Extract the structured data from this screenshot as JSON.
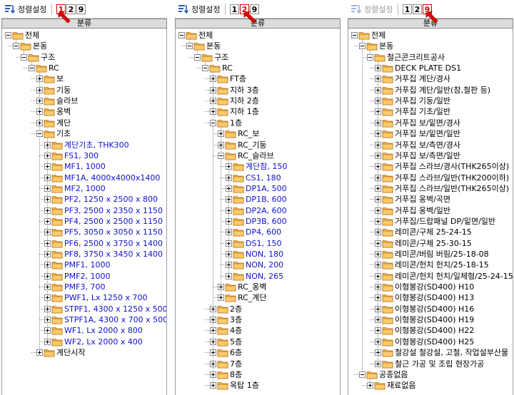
{
  "panels": [
    {
      "toolbar": {
        "sort_label": "정렬설정",
        "sort_enabled": true,
        "buttons": [
          "1",
          "2",
          "9"
        ],
        "active": "1"
      },
      "header": "분류",
      "rows": [
        {
          "t": "전체",
          "d": 0,
          "e": "minus",
          "l": false
        },
        {
          "t": "본동",
          "d": 1,
          "e": "minus",
          "l": true
        },
        {
          "t": "구조",
          "d": 2,
          "e": "minus",
          "l": true
        },
        {
          "t": "RC",
          "d": 3,
          "e": "minus",
          "l": true
        },
        {
          "t": "보",
          "d": 4,
          "e": "plus",
          "l": false
        },
        {
          "t": "기둥",
          "d": 4,
          "e": "plus",
          "l": false
        },
        {
          "t": "슬라브",
          "d": 4,
          "e": "plus",
          "l": false
        },
        {
          "t": "옹벽",
          "d": 4,
          "e": "plus",
          "l": false
        },
        {
          "t": "계단",
          "d": 4,
          "e": "plus",
          "l": false
        },
        {
          "t": "기초",
          "d": 4,
          "e": "minus",
          "l": false
        },
        {
          "t": "계단기초, THK300",
          "d": 5,
          "e": "plus",
          "c": "blue",
          "l": false
        },
        {
          "t": "FS1, 300",
          "d": 5,
          "e": "plus",
          "c": "blue",
          "l": false
        },
        {
          "t": "MF1, 1000",
          "d": 5,
          "e": "plus",
          "c": "blue",
          "l": false
        },
        {
          "t": "MF1A, 4000x4000x1400",
          "d": 5,
          "e": "plus",
          "c": "blue",
          "l": false
        },
        {
          "t": "MF2, 1000",
          "d": 5,
          "e": "plus",
          "c": "blue",
          "l": false
        },
        {
          "t": "PF2, 1250 x 2500 x 800",
          "d": 5,
          "e": "plus",
          "c": "blue",
          "l": false
        },
        {
          "t": "PF3, 2500 x 2350 x 1150",
          "d": 5,
          "e": "plus",
          "c": "blue",
          "l": false
        },
        {
          "t": "PF4, 2500 x 2500 x 1150",
          "d": 5,
          "e": "plus",
          "c": "blue",
          "l": false
        },
        {
          "t": "PF5, 3050 x 3050 x 1150",
          "d": 5,
          "e": "plus",
          "c": "blue",
          "l": false
        },
        {
          "t": "PF6, 2500 x 3750 x 1400",
          "d": 5,
          "e": "plus",
          "c": "blue",
          "l": false
        },
        {
          "t": "PF8, 3750 x 3450 x 1400",
          "d": 5,
          "e": "plus",
          "c": "blue",
          "l": false
        },
        {
          "t": "PMF1, 1000",
          "d": 5,
          "e": "plus",
          "c": "blue",
          "l": false
        },
        {
          "t": "PMF2, 1000",
          "d": 5,
          "e": "plus",
          "c": "blue",
          "l": false
        },
        {
          "t": "PMF3, 700",
          "d": 5,
          "e": "plus",
          "c": "blue",
          "l": false
        },
        {
          "t": "PWF1, Lx 1250 x 700",
          "d": 5,
          "e": "plus",
          "c": "blue",
          "l": false
        },
        {
          "t": "STPF1, 4300 x 1250 x 500",
          "d": 5,
          "e": "plus",
          "c": "blue",
          "l": false
        },
        {
          "t": "STPF1A, 4300 x 700 x 500",
          "d": 5,
          "e": "plus",
          "c": "blue",
          "l": false
        },
        {
          "t": "WF1, Lx 2000 x 800",
          "d": 5,
          "e": "plus",
          "c": "blue",
          "l": false
        },
        {
          "t": "WF2, Lx 2000 x 400",
          "d": 5,
          "e": "plus",
          "c": "blue",
          "l": true
        },
        {
          "t": "계단시작",
          "d": 4,
          "e": "plus",
          "l": true
        }
      ]
    },
    {
      "toolbar": {
        "sort_label": "정렬설정",
        "sort_enabled": true,
        "buttons": [
          "1",
          "2",
          "9"
        ],
        "active": "2"
      },
      "header": "분류",
      "rows": [
        {
          "t": "전체",
          "d": 0,
          "e": "minus",
          "l": false
        },
        {
          "t": "본동",
          "d": 1,
          "e": "minus",
          "l": true
        },
        {
          "t": "구조",
          "d": 2,
          "e": "minus",
          "l": true
        },
        {
          "t": "RC",
          "d": 3,
          "e": "minus",
          "l": true
        },
        {
          "t": "FT층",
          "d": 4,
          "e": "plus",
          "l": false
        },
        {
          "t": "지하 3층",
          "d": 4,
          "e": "plus",
          "l": false
        },
        {
          "t": "지하 2층",
          "d": 4,
          "e": "plus",
          "l": false
        },
        {
          "t": "지하 1층",
          "d": 4,
          "e": "plus",
          "l": false
        },
        {
          "t": "1층",
          "d": 4,
          "e": "minus",
          "l": false
        },
        {
          "t": "RC_보",
          "d": 5,
          "e": "plus",
          "l": false
        },
        {
          "t": "RC_기둥",
          "d": 5,
          "e": "plus",
          "l": false
        },
        {
          "t": "RC_슬라브",
          "d": 5,
          "e": "minus",
          "l": false
        },
        {
          "t": "계단참, 150",
          "d": 6,
          "e": "plus",
          "c": "blue",
          "l": false
        },
        {
          "t": "CS1, 180",
          "d": 6,
          "e": "plus",
          "c": "blue",
          "l": false
        },
        {
          "t": "DP1A, 500",
          "d": 6,
          "e": "plus",
          "c": "blue",
          "l": false
        },
        {
          "t": "DP1B, 600",
          "d": 6,
          "e": "plus",
          "c": "blue",
          "l": false
        },
        {
          "t": "DP2A, 600",
          "d": 6,
          "e": "plus",
          "c": "blue",
          "l": false
        },
        {
          "t": "DP3B, 600",
          "d": 6,
          "e": "plus",
          "c": "blue",
          "l": false
        },
        {
          "t": "DP4, 600",
          "d": 6,
          "e": "plus",
          "c": "blue",
          "l": false
        },
        {
          "t": "DS1, 150",
          "d": 6,
          "e": "plus",
          "c": "blue",
          "l": false
        },
        {
          "t": "NON, 180",
          "d": 6,
          "e": "plus",
          "c": "blue",
          "l": false
        },
        {
          "t": "NON, 200",
          "d": 6,
          "e": "plus",
          "c": "blue",
          "l": false
        },
        {
          "t": "NON, 265",
          "d": 6,
          "e": "plus",
          "c": "blue",
          "l": true
        },
        {
          "t": "RC_옹벽",
          "d": 5,
          "e": "plus",
          "l": false
        },
        {
          "t": "RC_계단",
          "d": 5,
          "e": "plus",
          "l": true
        },
        {
          "t": "2층",
          "d": 4,
          "e": "plus",
          "l": false
        },
        {
          "t": "3층",
          "d": 4,
          "e": "plus",
          "l": false
        },
        {
          "t": "4층",
          "d": 4,
          "e": "plus",
          "l": false
        },
        {
          "t": "5층",
          "d": 4,
          "e": "plus",
          "l": false
        },
        {
          "t": "6층",
          "d": 4,
          "e": "plus",
          "l": false
        },
        {
          "t": "7층",
          "d": 4,
          "e": "plus",
          "l": false
        },
        {
          "t": "8층",
          "d": 4,
          "e": "plus",
          "l": false
        },
        {
          "t": "옥탑 1층",
          "d": 4,
          "e": "plus",
          "l": true
        }
      ]
    },
    {
      "toolbar": {
        "sort_label": "정렬설정",
        "sort_enabled": false,
        "buttons": [
          "1",
          "2",
          "9"
        ],
        "active": "9"
      },
      "header": "분류",
      "rows": [
        {
          "t": "전체",
          "d": 0,
          "e": "minus",
          "l": false
        },
        {
          "t": "본동",
          "d": 1,
          "e": "minus",
          "l": false
        },
        {
          "t": "철근콘크리트공사",
          "d": 2,
          "e": "minus",
          "l": true
        },
        {
          "t": "DECK PLATE  DS1",
          "d": 3,
          "e": "plus",
          "l": false
        },
        {
          "t": "거푸집  계단/경사",
          "d": 3,
          "e": "plus",
          "l": false
        },
        {
          "t": "거푸집  계단/일반(참,철판 등)",
          "d": 3,
          "e": "plus",
          "l": false
        },
        {
          "t": "거푸집  기둥/일반",
          "d": 3,
          "e": "plus",
          "l": false
        },
        {
          "t": "거푸집  기초/일반",
          "d": 3,
          "e": "plus",
          "l": false
        },
        {
          "t": "거푸집  보/밑면/경사",
          "d": 3,
          "e": "plus",
          "l": false
        },
        {
          "t": "거푸집  보/밑면/일반",
          "d": 3,
          "e": "plus",
          "l": false
        },
        {
          "t": "거푸집  보/측면/경사",
          "d": 3,
          "e": "plus",
          "l": false
        },
        {
          "t": "거푸집  보/측면/일반",
          "d": 3,
          "e": "plus",
          "l": false
        },
        {
          "t": "거푸집  스라브/경사(THK265이상)",
          "d": 3,
          "e": "plus",
          "l": false
        },
        {
          "t": "거푸집  스라브/일반(THK200이하)",
          "d": 3,
          "e": "plus",
          "l": false
        },
        {
          "t": "거푸집  스라브/일반(THK265이상)",
          "d": 3,
          "e": "plus",
          "l": false
        },
        {
          "t": "거푸집  옹벽/곡면",
          "d": 3,
          "e": "plus",
          "l": false
        },
        {
          "t": "거푸집  옹벽/일반",
          "d": 3,
          "e": "plus",
          "l": false
        },
        {
          "t": "거푸집/드랍패널  DP/밑면/일반",
          "d": 3,
          "e": "plus",
          "l": false
        },
        {
          "t": "레미콘/구체  25-24-15",
          "d": 3,
          "e": "plus",
          "l": false
        },
        {
          "t": "레미콘/구체  25-30-15",
          "d": 3,
          "e": "plus",
          "l": false
        },
        {
          "t": "레미콘/버림  버림/25-18-08",
          "d": 3,
          "e": "plus",
          "l": false
        },
        {
          "t": "레미콘/헌치  헌치/25-18-15",
          "d": 3,
          "e": "plus",
          "l": false
        },
        {
          "t": "레미콘/헌치  헌치/일체형/25-24-15",
          "d": 3,
          "e": "plus",
          "l": false
        },
        {
          "t": "이형봉강(SD400)  H10",
          "d": 3,
          "e": "plus",
          "l": false
        },
        {
          "t": "이형봉강(SD400)  H13",
          "d": 3,
          "e": "plus",
          "l": false
        },
        {
          "t": "이형봉강(SD400)  H16",
          "d": 3,
          "e": "plus",
          "l": false
        },
        {
          "t": "이형봉강(SD400)  H19",
          "d": 3,
          "e": "plus",
          "l": false
        },
        {
          "t": "이형봉강(SD400)  H22",
          "d": 3,
          "e": "plus",
          "l": false
        },
        {
          "t": "이형봉강(SD400)  H25",
          "d": 3,
          "e": "plus",
          "l": false
        },
        {
          "t": "철강설  철강설, 고철, 작업설부산물",
          "d": 3,
          "e": "plus",
          "l": false
        },
        {
          "t": "철근 가공 및 조립  현장가공",
          "d": 3,
          "e": "plus",
          "l": true
        },
        {
          "t": "공종없음",
          "d": 1,
          "e": "minus",
          "l": true
        },
        {
          "t": "재료없음",
          "d": 2,
          "e": "plus",
          "l": true
        }
      ]
    }
  ],
  "colors": {
    "blue_text": "#1010cc",
    "active_red": "#d00000",
    "header_bg": "#dcdcdc",
    "folder": "#f4a83a"
  },
  "icons": {
    "sort": "sort-settings-icon",
    "folder": "folder-icon",
    "arrow": "red-pointer-arrow-icon"
  }
}
